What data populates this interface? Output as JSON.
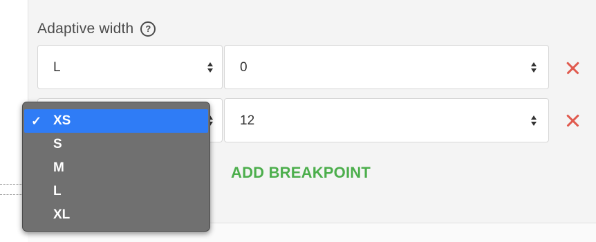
{
  "form": {
    "title": "Adaptive width",
    "help_icon": "?",
    "rows": [
      {
        "size": "L",
        "value": "0"
      },
      {
        "size": "XS",
        "value": "12"
      }
    ],
    "add_label": "ADD BREAKPOINT"
  },
  "dropdown": {
    "selected": "XS",
    "check_icon": "✓",
    "options": [
      "XS",
      "S",
      "M",
      "L",
      "XL"
    ]
  },
  "colors": {
    "panel_bg": "#f4f4f4",
    "remove_icon": "#e05a4e",
    "add_button": "#4cae4c",
    "selection": "#2f7cf6",
    "dropdown_bg": "#707070"
  }
}
